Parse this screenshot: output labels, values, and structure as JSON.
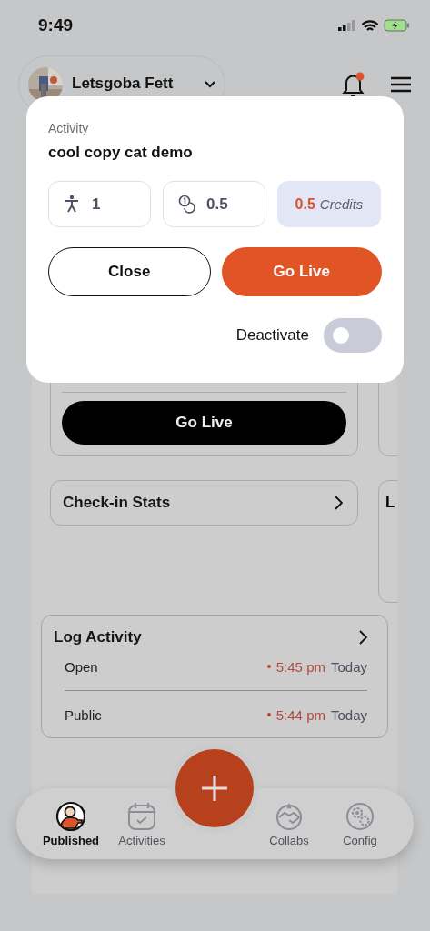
{
  "status_bar": {
    "time": "9:49"
  },
  "header": {
    "name": "Letsgoba Fett",
    "has_notification": true
  },
  "background": {
    "go_live_button": "Go Live",
    "check_in": "Check-in Stats",
    "side_card": "L"
  },
  "log": {
    "title": "Log Activity",
    "rows": [
      {
        "label": "Open",
        "time": "5:45 pm",
        "day": "Today"
      },
      {
        "label": "Public",
        "time": "5:44 pm",
        "day": "Today"
      }
    ]
  },
  "nav": {
    "items": [
      {
        "label": "Published",
        "kind": "person",
        "selected": true
      },
      {
        "label": "Activities",
        "kind": "calendar",
        "selected": false
      },
      {
        "label": "Collabs",
        "kind": "handshake",
        "selected": false
      },
      {
        "label": "Config",
        "kind": "gears",
        "selected": false
      }
    ]
  },
  "modal": {
    "label": "Activity",
    "title": "cool copy cat demo",
    "stats": [
      {
        "kind": "people",
        "value": "1"
      },
      {
        "kind": "coins",
        "value": "0.5"
      }
    ],
    "credits": {
      "amount": "0.5",
      "unit": "Credits"
    },
    "buttons": [
      {
        "label": "Close",
        "kind": "outline"
      },
      {
        "label": "Go Live",
        "kind": "primary"
      }
    ],
    "toggle": {
      "label": "Deactivate",
      "on": false
    }
  }
}
